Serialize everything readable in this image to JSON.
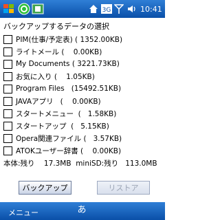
{
  "statusbar": {
    "clock": "10:41",
    "network_label": "3G"
  },
  "heading": "バックアップするデータの選択",
  "items": [
    {
      "label": "PIM(仕事/予定表) ( 1352.00KB)",
      "checked": false
    },
    {
      "label": "ライトメール (    0.00KB)",
      "checked": false
    },
    {
      "label": "My Documents ( 3221.73KB)",
      "checked": false
    },
    {
      "label": "お気に入り (    1.05KB)",
      "checked": false
    },
    {
      "label": "Program Files   (15492.51KB)",
      "checked": false
    },
    {
      "label": "JAVAアプリ   (    0.00KB)",
      "checked": false
    },
    {
      "label": "スタートメニュー  (   1.58KB)",
      "checked": false
    },
    {
      "label": "スタートアップ  (   5.15KB)",
      "checked": false
    },
    {
      "label": "Opera関連ファイル (   3.57KB)",
      "checked": false
    },
    {
      "label": "ATOKユーザー辞書 (    0.00KB)",
      "checked": false
    }
  ],
  "remaining": "本体:残り    17.3MB  miniSD:残り   113.0MB",
  "buttons": {
    "backup": "バックアップ",
    "restore": "リストア"
  },
  "menubar": {
    "menu": "メニュー",
    "ime_glyph": "あ"
  }
}
